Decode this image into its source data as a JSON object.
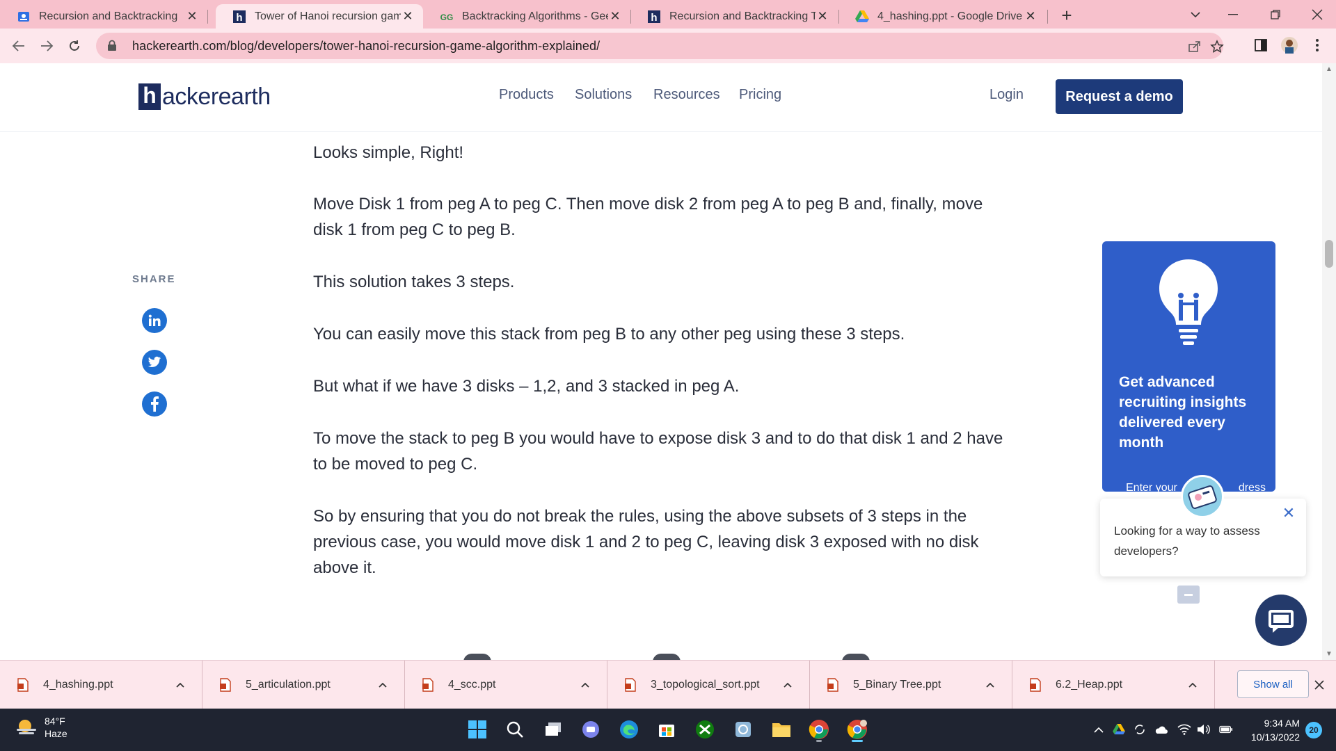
{
  "browser": {
    "tabs": [
      {
        "title": "Recursion and Backtracking",
        "icon": "classroom-icon",
        "active": false
      },
      {
        "title": "Tower of Hanoi recursion game a",
        "icon": "hackerearth-icon",
        "active": true
      },
      {
        "title": "Backtracking Algorithms - Geeks",
        "icon": "geeksforgeeks-icon",
        "active": false
      },
      {
        "title": "Recursion and Backtracking Tuto",
        "icon": "hackerearth-icon",
        "active": false
      },
      {
        "title": "4_hashing.ppt - Google Drive",
        "icon": "google-drive-icon",
        "active": false
      }
    ],
    "url": "hackerearth.com/blog/developers/tower-hanoi-recursion-game-algorithm-explained/"
  },
  "site": {
    "logo_letter": "h",
    "logo_text": "ackerearth",
    "nav": [
      "Products",
      "Solutions",
      "Resources",
      "Pricing"
    ],
    "login": "Login",
    "demo_button": "Request a demo"
  },
  "share": {
    "label": "SHARE",
    "networks": [
      "linkedin-icon",
      "twitter-icon",
      "facebook-icon"
    ]
  },
  "article": {
    "paragraphs": [
      "Looks simple, Right!",
      "Move Disk 1 from peg A to peg C. Then move disk 2 from peg A to peg B and, finally, move disk 1 from peg C to peg B.",
      "This solution takes 3 steps.",
      "You can easily move this stack from peg B to any other peg using these 3 steps.",
      "But what if we have 3 disks – 1,2, and 3 stacked in peg A.",
      "To move the stack to peg B you would have to expose disk 3 and to do that disk 1 and 2 have to be moved to peg C.",
      "So by ensuring that you do not break the rules, using the above subsets of 3 steps in the previous case, you would move disk 1 and 2 to peg C, leaving disk 3 exposed with no disk above it."
    ]
  },
  "newsletter": {
    "title": "Get advanced recruiting insights delivered every month",
    "email_placeholder_visible_start": "Enter your",
    "email_placeholder_visible_end": "dress"
  },
  "chat": {
    "message": "Looking for a way to assess developers?"
  },
  "downloads": {
    "files": [
      "4_hashing.ppt",
      "5_articulation.ppt",
      "4_scc.ppt",
      "3_topological_sort.ppt",
      "5_Binary Tree.ppt",
      "6.2_Heap.ppt"
    ],
    "show_all": "Show all"
  },
  "taskbar": {
    "weather_temp": "84°F",
    "weather_cond": "Haze",
    "time": "9:34 AM",
    "date": "10/13/2022",
    "notifications": "20"
  },
  "colors": {
    "brand_navy": "#1d2c5e",
    "demo_button": "#1d3a7a",
    "newsletter_bg": "#2f5ec9",
    "tab_bar": "#f7c1cc"
  }
}
